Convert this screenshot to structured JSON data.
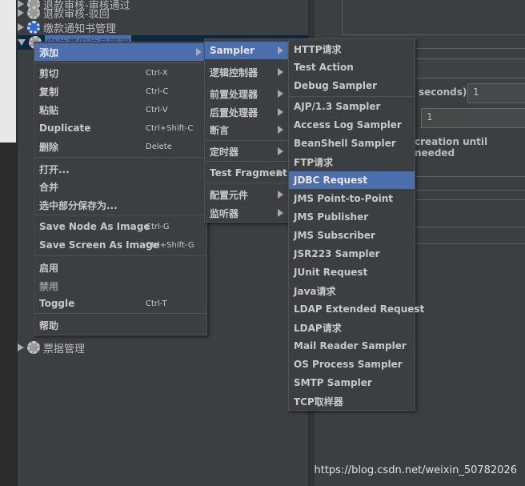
{
  "tree": {
    "top_items": [
      "退款审核-审核通过",
      "退款审核-驳回",
      "缴款通知书管理",
      "定位费用信息管理"
    ],
    "bottom_items": [
      "票据管理"
    ]
  },
  "right_panel": {
    "ramp_label": "seconds):",
    "ramp_value": "1",
    "loop_value": "1",
    "delay_label": "creation until needed"
  },
  "menu_main": {
    "items": [
      {
        "label": "添加",
        "shortcut": "",
        "submenu": true,
        "highlight": true
      },
      {
        "label": "剪切",
        "shortcut": "Ctrl-X"
      },
      {
        "label": "复制",
        "shortcut": "Ctrl-C"
      },
      {
        "label": "粘贴",
        "shortcut": "Ctrl-V"
      },
      {
        "label": "Duplicate",
        "shortcut": "Ctrl+Shift-C"
      },
      {
        "label": "删除",
        "shortcut": "Delete"
      },
      {
        "label": "打开...",
        "shortcut": ""
      },
      {
        "label": "合并",
        "shortcut": ""
      },
      {
        "label": "选中部分保存为...",
        "shortcut": ""
      },
      {
        "label": "Save Node As Image",
        "shortcut": "Ctrl-G"
      },
      {
        "label": "Save Screen As Image",
        "shortcut": "Ctrl+Shift-G"
      },
      {
        "label": "启用",
        "shortcut": ""
      },
      {
        "label": "禁用",
        "shortcut": "",
        "disabled": true
      },
      {
        "label": "Toggle",
        "shortcut": "Ctrl-T"
      },
      {
        "label": "帮助",
        "shortcut": ""
      }
    ]
  },
  "menu_add": {
    "items": [
      "Sampler",
      "逻辑控制器",
      "前置处理器",
      "后置处理器",
      "断言",
      "定时器",
      "Test Fragment",
      "配置元件",
      "监听器"
    ]
  },
  "menu_sampler": {
    "items": [
      "HTTP请求",
      "Test Action",
      "Debug Sampler",
      "AJP/1.3 Sampler",
      "Access Log Sampler",
      "BeanShell Sampler",
      "FTP请求",
      "JDBC Request",
      "JMS Point-to-Point",
      "JMS Publisher",
      "JMS Subscriber",
      "JSR223 Sampler",
      "JUnit Request",
      "Java请求",
      "LDAP Extended Request",
      "LDAP请求",
      "Mail Reader Sampler",
      "OS Process Sampler",
      "SMTP Sampler",
      "TCP取样器"
    ],
    "highlighted": "JDBC Request"
  },
  "watermark": "https://blog.csdn.net/weixin_50782026",
  "colors": {
    "background": "#3c3f41",
    "highlight": "#4b6eaf"
  }
}
